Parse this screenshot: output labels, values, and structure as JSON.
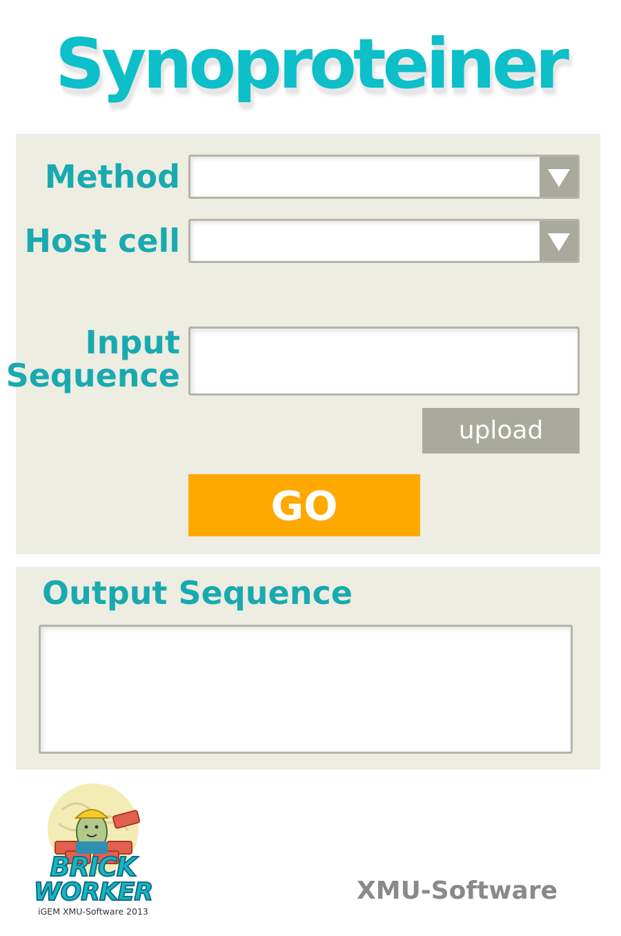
{
  "header": {
    "title": "Synoproteiner"
  },
  "form": {
    "method_label": "Method",
    "method_value": "",
    "host_cell_label": "Host cell",
    "host_cell_value": "",
    "input_sequence_label": "Input\nSequence",
    "input_sequence_value": "",
    "upload_label": "upload",
    "go_label": "GO"
  },
  "output": {
    "heading": "Output Sequence",
    "value": ""
  },
  "footer": {
    "logo": {
      "line1": "BRICK",
      "line2": "WORKER",
      "tagline": "iGEM XMU-Software 2013"
    },
    "brand": "XMU-Software"
  },
  "colors": {
    "title": "#0cbfc8",
    "label": "#19aab0",
    "panel_background": "#eeede2",
    "go_button": "#ffa800",
    "upload_button": "#a9aa9c",
    "footer_text": "#8a8a8a"
  },
  "icons": {
    "select_arrow": "triangle-down-icon",
    "logo": "brick-worker-mascot"
  }
}
